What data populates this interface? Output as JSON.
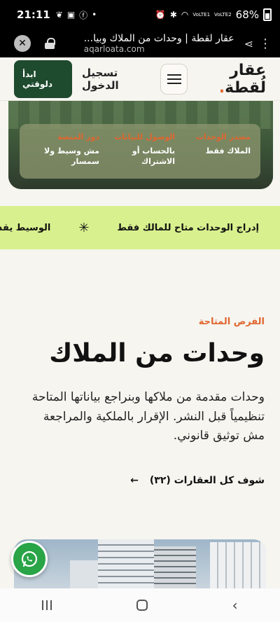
{
  "status_bar": {
    "time": "21:11",
    "battery_percent": "68%",
    "network_labels": [
      "VoLTE1",
      "VoLTE2"
    ]
  },
  "browser": {
    "close_label": "✕",
    "page_title": "عقار لقطة | وحدات من الملاك وبيا...",
    "url": "aqarloata.com"
  },
  "header": {
    "logo_text": "عقار لُقطة",
    "logo_dot": ".",
    "login_label": "تسجيل الدخول",
    "cta_label": "ابدأ دلوقتي"
  },
  "hero_panel": {
    "columns": [
      {
        "label": "مصدر الوحدات",
        "value": "الملاك فقط"
      },
      {
        "label": "الوصول للبيانات",
        "value": "بالحساب أو الاشتراك"
      },
      {
        "label": "دور المنصة",
        "value": "مش وسيط ولا سمسار"
      }
    ]
  },
  "marquee": {
    "item_1": "إدراج الوحدات متاح للمالك فقط",
    "separator": "✳",
    "item_2": "الوسيط يقدر"
  },
  "section": {
    "kicker": "الفرص المتاحة",
    "heading": "وحدات من الملاك",
    "paragraph": "وحدات مقدمة من ملاكها وبنراجع بياناتها المتاحة تنظيمياً قبل النشر. الإقرار بالملكية والمراجعة مش توثيق قانوني.",
    "all_properties_link": "شوف كل العقارات (٣٢)",
    "arrow": "←"
  },
  "colors": {
    "accent": "#e0662f",
    "brand_green": "#1e4a2e",
    "marquee_bg": "#d8f08e",
    "whatsapp_green": "#29a447"
  }
}
